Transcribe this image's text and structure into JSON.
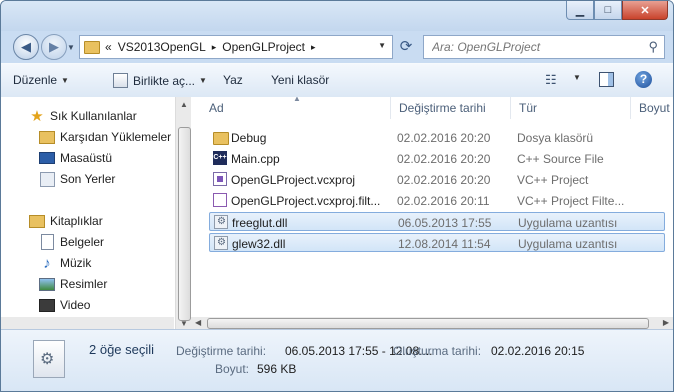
{
  "window": {
    "controls": {
      "minimize_icon": "minimize-icon",
      "maximize_icon": "maximize-icon",
      "close_icon": "close-icon"
    }
  },
  "address_bar": {
    "overflow": "«",
    "crumbs": [
      "VS2013OpenGL",
      "OpenGLProject"
    ],
    "separator": "▸"
  },
  "search": {
    "placeholder": "Ara: OpenGLProject"
  },
  "toolbar": {
    "organize": "Düzenle",
    "include": "Birlikte aç...",
    "burn": "Yaz",
    "new_folder": "Yeni klasör"
  },
  "sidebar": {
    "favorites_header": "Sık Kullanılanlar",
    "favorites": [
      {
        "label": "Karşıdan Yüklemeler",
        "icon": "downloads-folder-icon"
      },
      {
        "label": "Masaüstü",
        "icon": "desktop-icon"
      },
      {
        "label": "Son Yerler",
        "icon": "recent-places-icon"
      }
    ],
    "libraries_header": "Kitaplıklar",
    "libraries": [
      {
        "label": "Belgeler",
        "icon": "documents-icon"
      },
      {
        "label": "Müzik",
        "icon": "music-icon"
      },
      {
        "label": "Resimler",
        "icon": "pictures-icon"
      },
      {
        "label": "Video",
        "icon": "video-icon"
      }
    ]
  },
  "columns": {
    "name": "Ad",
    "date": "Değiştirme tarihi",
    "type": "Tür",
    "size": "Boyut"
  },
  "files": [
    {
      "name": "Debug",
      "date": "02.02.2016 20:20",
      "type": "Dosya klasörü",
      "icon": "folder-icon",
      "selected": false
    },
    {
      "name": "Main.cpp",
      "date": "02.02.2016 20:20",
      "type": "C++ Source File",
      "icon": "cpp-file-icon",
      "selected": false
    },
    {
      "name": "OpenGLProject.vcxproj",
      "date": "02.02.2016 20:20",
      "type": "VC++ Project",
      "icon": "vcxproj-file-icon",
      "selected": false
    },
    {
      "name": "OpenGLProject.vcxproj.filt...",
      "date": "02.02.2016 20:11",
      "type": "VC++ Project Filte...",
      "icon": "filters-file-icon",
      "selected": false
    },
    {
      "name": "freeglut.dll",
      "date": "06.05.2013 17:55",
      "type": "Uygulama uzantısı",
      "icon": "dll-file-icon",
      "selected": true
    },
    {
      "name": "glew32.dll",
      "date": "12.08.2014 11:54",
      "type": "Uygulama uzantısı",
      "icon": "dll-file-icon",
      "selected": true
    }
  ],
  "details": {
    "count": "2 öğe seçili",
    "modified_label": "Değiştirme tarihi:",
    "modified_value": "06.05.2013 17:55 - 12.08....",
    "created_label": "Oluşturma tarihi:",
    "created_value": "02.02.2016 20:15",
    "size_label": "Boyut:",
    "size_value": "596 KB"
  }
}
